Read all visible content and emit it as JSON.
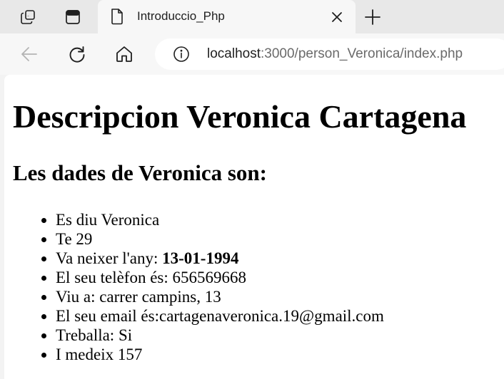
{
  "browser": {
    "tab": {
      "title": "Introduccio_Php"
    },
    "address_bar": {
      "url_host": "localhost",
      "url_path": ":3000/person_Veronica/index.php"
    },
    "icons": {
      "workspaces": "workspaces-icon",
      "tab_actions": "tab-actions-icon",
      "page_favicon": "page-icon",
      "close_tab": "close-icon",
      "new_tab": "plus-icon",
      "back": "back-arrow-icon",
      "refresh": "refresh-icon",
      "home": "home-icon",
      "site_info": "info-icon"
    }
  },
  "page": {
    "heading": "Descripcion Veronica Cartagena",
    "subheading": "Les dades de Veronica son:",
    "items": [
      {
        "text": "Es diu Veronica"
      },
      {
        "text": "Te 29"
      },
      {
        "label": "Va neixer l'any: ",
        "strong": "13-01-1994"
      },
      {
        "text": "El seu telèfon és: 656569668"
      },
      {
        "text": "Viu a: carrer campins, 13"
      },
      {
        "text": "El seu email és:cartagenaveronica.19@gmail.com"
      },
      {
        "text": "Treballa: Si"
      },
      {
        "text": "I medeix 157"
      }
    ]
  }
}
